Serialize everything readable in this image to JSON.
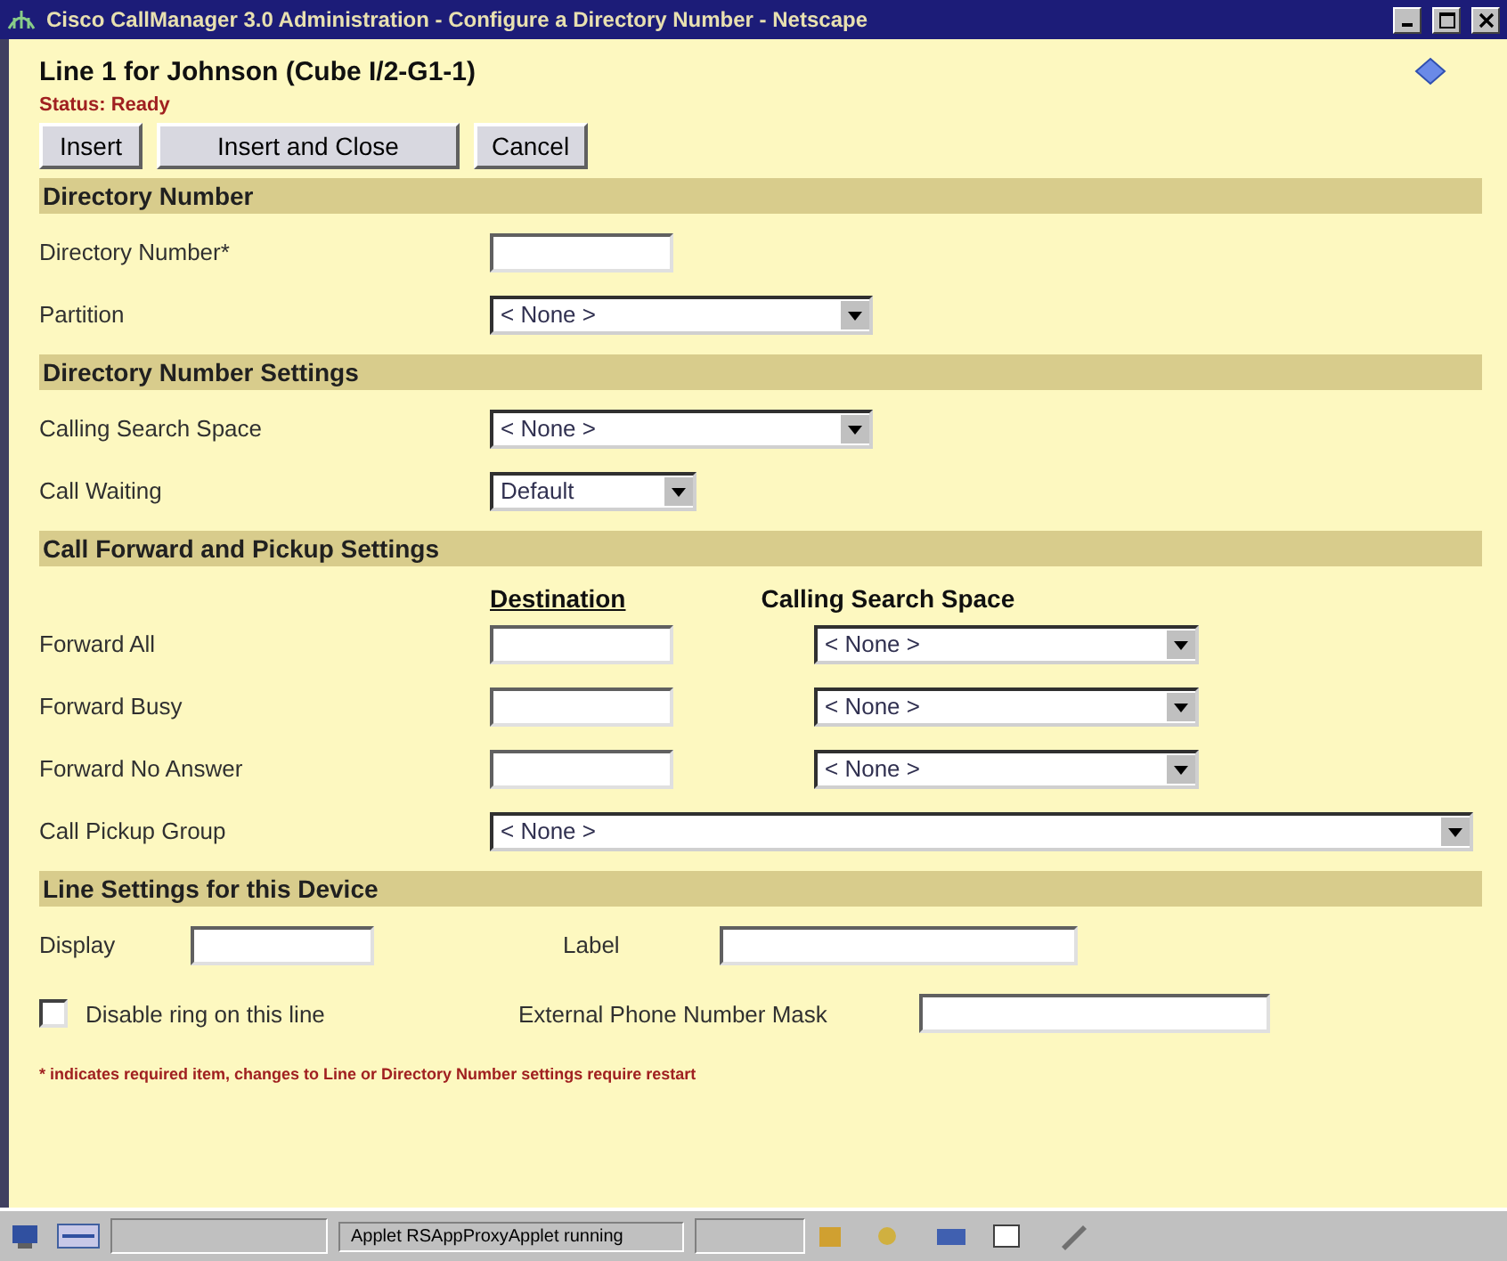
{
  "window": {
    "title": "Cisco CallManager 3.0 Administration - Configure a Directory Number - Netscape"
  },
  "page": {
    "heading": "Line 1 for Johnson (Cube I/2-G1-1)",
    "status": "Status: Ready"
  },
  "buttons": [
    "Insert",
    "Insert and Close",
    "Cancel"
  ],
  "sections": [
    {
      "title": "Directory Number",
      "rows": [
        {
          "kind": "text",
          "label": "Directory Number*"
        },
        {
          "kind": "select",
          "label": "Partition",
          "value": "< None >"
        }
      ]
    },
    {
      "title": "Directory Number Settings",
      "rows": [
        {
          "kind": "select",
          "label": "Calling Search Space",
          "value": "< None >"
        },
        {
          "kind": "small_select",
          "label": "Call Waiting",
          "value": "Default"
        }
      ]
    },
    {
      "title": "Call Forward and Pickup Settings",
      "columns": [
        "Destination",
        "Calling Search Space"
      ],
      "rows": [
        {
          "kind": "forward",
          "label": "Forward All",
          "value": "< None >"
        },
        {
          "kind": "forward",
          "label": "Forward Busy",
          "value": "< None >"
        },
        {
          "kind": "forward",
          "label": "Forward No Answer",
          "value": "< None >"
        },
        {
          "kind": "wide_select",
          "label": "Call Pickup Group",
          "value": "< None >"
        }
      ]
    },
    {
      "title": "Line Settings for this Device",
      "rows": [
        {
          "kind": "two_fields",
          "label": "Display",
          "second_label": "Label"
        },
        {
          "kind": "checkbox_field",
          "label": "Disable ring on this line",
          "checked": false,
          "second_label": "External Phone Number Mask"
        }
      ]
    }
  ],
  "note": "* indicates required item, changes to Line or Directory Number settings require restart",
  "status_bar": {
    "text": "Applet RSAppProxyApplet running"
  }
}
